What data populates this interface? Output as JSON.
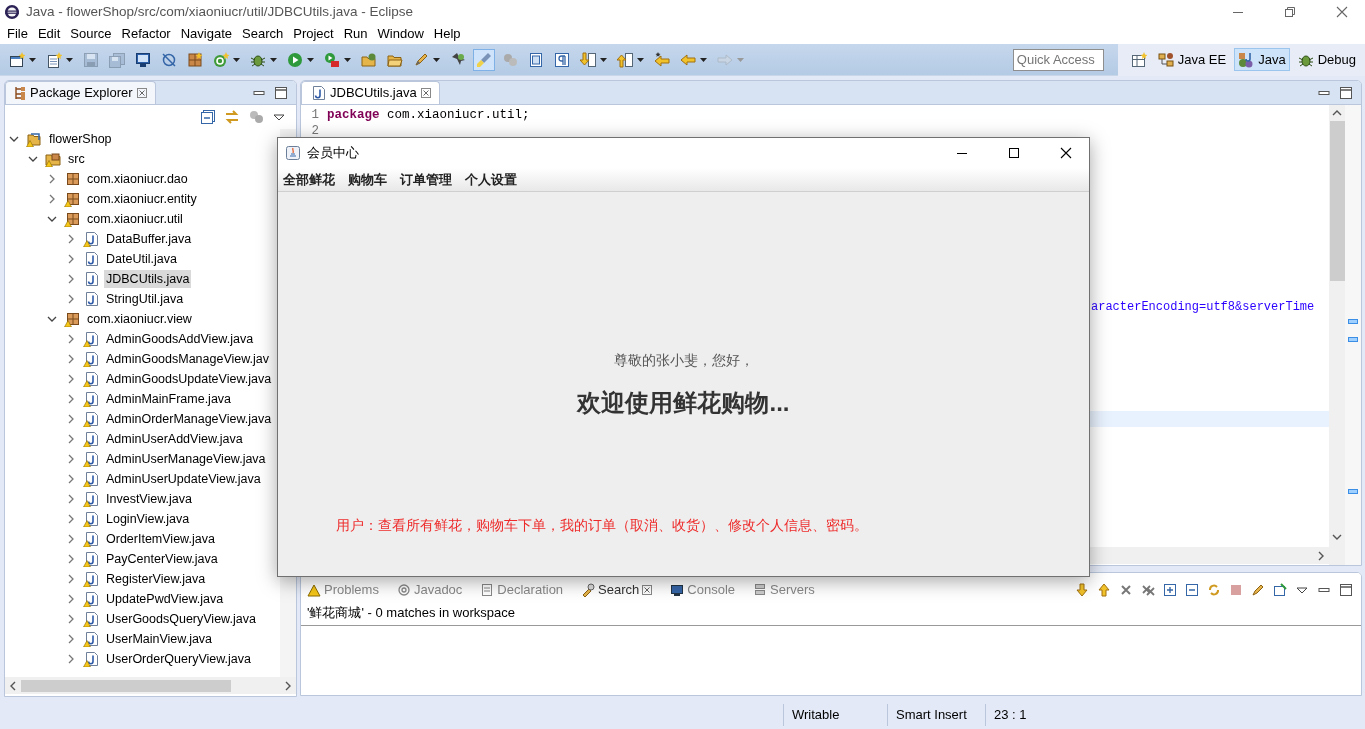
{
  "window": {
    "title": "Java - flowerShop/src/com/xiaoniucr/util/JDBCUtils.java - Eclipse"
  },
  "menu": [
    "File",
    "Edit",
    "Source",
    "Refactor",
    "Navigate",
    "Search",
    "Project",
    "Run",
    "Window",
    "Help"
  ],
  "toolbar": {
    "items": [
      {
        "kind": "new",
        "dropdown": true,
        "pressed": false,
        "disabled": false
      },
      {
        "kind": "new-page",
        "dropdown": true,
        "pressed": false,
        "disabled": false
      },
      {
        "kind": "save",
        "dropdown": false,
        "pressed": false,
        "disabled": true
      },
      {
        "kind": "save-all",
        "dropdown": false,
        "pressed": false,
        "disabled": true
      },
      {
        "kind": "monitor",
        "dropdown": false,
        "pressed": false,
        "disabled": false
      },
      {
        "kind": "skip",
        "dropdown": false,
        "pressed": false,
        "disabled": false
      },
      {
        "kind": "package",
        "dropdown": false,
        "pressed": false,
        "disabled": false
      },
      {
        "kind": "new-class",
        "dropdown": true,
        "pressed": false,
        "disabled": false
      },
      {
        "kind": "debug",
        "dropdown": true,
        "pressed": false,
        "disabled": false
      },
      {
        "kind": "run",
        "dropdown": true,
        "pressed": false,
        "disabled": false
      },
      {
        "kind": "run-external",
        "dropdown": true,
        "pressed": false,
        "disabled": false
      },
      {
        "kind": "open-type",
        "dropdown": false,
        "pressed": false,
        "disabled": false
      },
      {
        "kind": "open-folder",
        "dropdown": false,
        "pressed": false,
        "disabled": false
      },
      {
        "kind": "pen",
        "dropdown": true,
        "pressed": false,
        "disabled": false
      },
      {
        "kind": "pin",
        "dropdown": false,
        "pressed": false,
        "disabled": false
      },
      {
        "kind": "brush",
        "dropdown": false,
        "pressed": true,
        "disabled": false
      },
      {
        "kind": "blocks",
        "dropdown": false,
        "pressed": false,
        "disabled": false
      },
      {
        "kind": "list-page",
        "dropdown": false,
        "pressed": false,
        "disabled": false
      },
      {
        "kind": "pilcrow",
        "dropdown": false,
        "pressed": false,
        "disabled": false
      },
      {
        "kind": "next",
        "dropdown": true,
        "pressed": false,
        "disabled": false
      },
      {
        "kind": "previous",
        "dropdown": true,
        "pressed": false,
        "disabled": false
      },
      {
        "kind": "last-edit",
        "dropdown": false,
        "pressed": false,
        "disabled": false
      },
      {
        "kind": "back",
        "dropdown": true,
        "pressed": false,
        "disabled": false
      },
      {
        "kind": "forward",
        "dropdown": true,
        "pressed": false,
        "disabled": true
      }
    ],
    "quick_access": {
      "placeholder": "Quick Access"
    },
    "perspectives": [
      {
        "label": "Java EE",
        "kind": "javaee",
        "selected": false
      },
      {
        "label": "Java",
        "kind": "java",
        "selected": true
      },
      {
        "label": "Debug",
        "kind": "debug",
        "selected": false
      }
    ]
  },
  "package_explorer": {
    "title": "Package Explorer",
    "tree": [
      {
        "label": "flowerShop",
        "kind": "project",
        "expanded": true,
        "selected": false,
        "warning": true,
        "children": [
          {
            "label": "src",
            "kind": "source-folder",
            "expanded": true,
            "selected": false,
            "warning": true,
            "children": [
              {
                "label": "com.xiaoniucr.dao",
                "kind": "package",
                "expanded": false,
                "selected": false,
                "warning": false
              },
              {
                "label": "com.xiaoniucr.entity",
                "kind": "package",
                "expanded": false,
                "selected": false,
                "warning": true
              },
              {
                "label": "com.xiaoniucr.util",
                "kind": "package",
                "expanded": true,
                "selected": false,
                "warning": true,
                "children": [
                  {
                    "label": "DataBuffer.java",
                    "kind": "java",
                    "expanded": false,
                    "selected": false,
                    "warning": true
                  },
                  {
                    "label": "DateUtil.java",
                    "kind": "java",
                    "expanded": false,
                    "selected": false,
                    "warning": false
                  },
                  {
                    "label": "JDBCUtils.java",
                    "kind": "java",
                    "expanded": false,
                    "selected": true,
                    "warning": false
                  },
                  {
                    "label": "StringUtil.java",
                    "kind": "java",
                    "expanded": false,
                    "selected": false,
                    "warning": false
                  }
                ]
              },
              {
                "label": "com.xiaoniucr.view",
                "kind": "package",
                "expanded": true,
                "selected": false,
                "warning": true,
                "children": [
                  {
                    "label": "AdminGoodsAddView.java",
                    "kind": "java",
                    "expanded": false,
                    "selected": false,
                    "warning": true
                  },
                  {
                    "label": "AdminGoodsManageView.jav",
                    "kind": "java",
                    "expanded": false,
                    "selected": false,
                    "warning": true
                  },
                  {
                    "label": "AdminGoodsUpdateView.java",
                    "kind": "java",
                    "expanded": false,
                    "selected": false,
                    "warning": true
                  },
                  {
                    "label": "AdminMainFrame.java",
                    "kind": "java",
                    "expanded": false,
                    "selected": false,
                    "warning": true
                  },
                  {
                    "label": "AdminOrderManageView.java",
                    "kind": "java",
                    "expanded": false,
                    "selected": false,
                    "warning": true
                  },
                  {
                    "label": "AdminUserAddView.java",
                    "kind": "java",
                    "expanded": false,
                    "selected": false,
                    "warning": true
                  },
                  {
                    "label": "AdminUserManageView.java",
                    "kind": "java",
                    "expanded": false,
                    "selected": false,
                    "warning": true
                  },
                  {
                    "label": "AdminUserUpdateView.java",
                    "kind": "java",
                    "expanded": false,
                    "selected": false,
                    "warning": true
                  },
                  {
                    "label": "InvestView.java",
                    "kind": "java",
                    "expanded": false,
                    "selected": false,
                    "warning": true
                  },
                  {
                    "label": "LoginView.java",
                    "kind": "java",
                    "expanded": false,
                    "selected": false,
                    "warning": true
                  },
                  {
                    "label": "OrderItemView.java",
                    "kind": "java",
                    "expanded": false,
                    "selected": false,
                    "warning": true
                  },
                  {
                    "label": "PayCenterView.java",
                    "kind": "java",
                    "expanded": false,
                    "selected": false,
                    "warning": true
                  },
                  {
                    "label": "RegisterView.java",
                    "kind": "java",
                    "expanded": false,
                    "selected": false,
                    "warning": true
                  },
                  {
                    "label": "UpdatePwdView.java",
                    "kind": "java",
                    "expanded": false,
                    "selected": false,
                    "warning": true
                  },
                  {
                    "label": "UserGoodsQueryView.java",
                    "kind": "java",
                    "expanded": false,
                    "selected": false,
                    "warning": true
                  },
                  {
                    "label": "UserMainView.java",
                    "kind": "java",
                    "expanded": false,
                    "selected": false,
                    "warning": true
                  },
                  {
                    "label": "UserOrderQueryView.java",
                    "kind": "java",
                    "expanded": false,
                    "selected": false,
                    "warning": true
                  }
                ]
              }
            ]
          }
        ]
      }
    ]
  },
  "editor": {
    "tab": {
      "label": "JDBCUtils.java",
      "selected": true
    },
    "lines": [
      {
        "number": "1",
        "kind": "code",
        "code": "package com.xiaoniucr.util;",
        "current": false
      },
      {
        "number": "2",
        "kind": "code",
        "current": false
      },
      {
        "kind": "blank",
        "current": false
      },
      {
        "kind": "blank",
        "current": false
      },
      {
        "kind": "blank",
        "current": false
      },
      {
        "kind": "blank",
        "current": false
      },
      {
        "kind": "blank",
        "current": false
      },
      {
        "kind": "blank",
        "current": false
      },
      {
        "kind": "blank",
        "current": false
      },
      {
        "kind": "blank",
        "current": false
      },
      {
        "kind": "blank",
        "current": false
      },
      {
        "kind": "blank",
        "current": false
      },
      {
        "kind": "fragment",
        "code": "aracterEncoding=utf8&serverTime",
        "current": false
      },
      {
        "kind": "blank",
        "current": false
      },
      {
        "kind": "blank",
        "current": false
      },
      {
        "kind": "blank",
        "current": false
      },
      {
        "kind": "blank",
        "current": false
      },
      {
        "kind": "blank",
        "current": false
      },
      {
        "kind": "blank",
        "current": false
      },
      {
        "kind": "blank",
        "current": true
      }
    ]
  },
  "bottom_panel": {
    "tabs": [
      {
        "label": "Problems",
        "kind": "problems",
        "selected": false
      },
      {
        "label": "Javadoc",
        "kind": "javadoc",
        "selected": false
      },
      {
        "label": "Declaration",
        "kind": "declaration",
        "selected": false
      },
      {
        "label": "Search",
        "kind": "search",
        "selected": true
      },
      {
        "label": "Console",
        "kind": "console",
        "selected": false
      },
      {
        "label": "Servers",
        "kind": "servers",
        "selected": false
      }
    ],
    "result": "'鲜花商城' - 0 matches in workspace"
  },
  "status_bar": [
    "Writable",
    "Smart Insert",
    "23 : 1"
  ],
  "dialog": {
    "title": "会员中心",
    "menu": [
      "全部鲜花",
      "购物车",
      "订单管理",
      "个人设置"
    ],
    "greeting": "尊敬的张小斐，您好，",
    "heading": "欢迎使用鲜花购物...",
    "description": "用户：查看所有鲜花，购物车下单，我的订单（取消、收货）、修改个人信息、密码。"
  }
}
